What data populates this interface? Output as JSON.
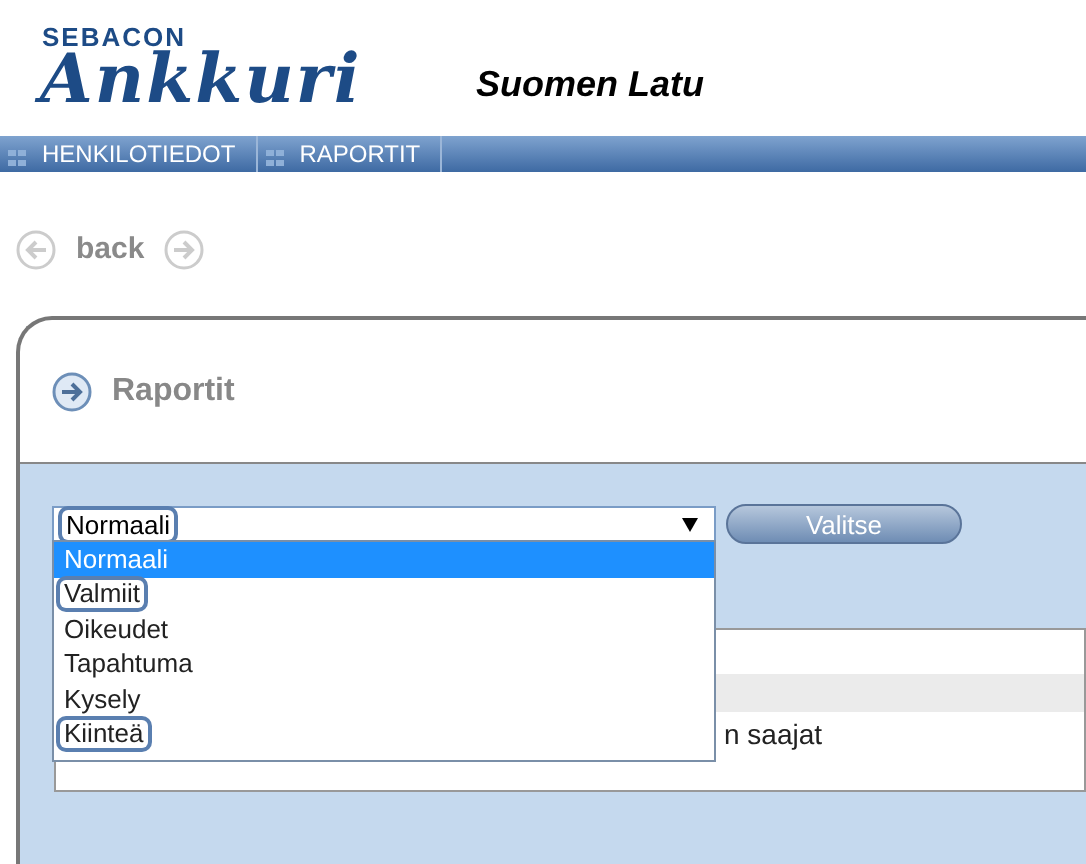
{
  "logo": {
    "brand": "SEBACON",
    "product": "Ankkuri"
  },
  "organization": "Suomen Latu",
  "nav": [
    {
      "label": "HENKILOTIEDOT"
    },
    {
      "label": "RAPORTIT"
    }
  ],
  "back": {
    "label": "back"
  },
  "panel": {
    "title": "Raportit",
    "select": {
      "value": "Normaali",
      "annotated": true,
      "expanded": true
    },
    "button": "Valitse",
    "options": [
      {
        "label": "Normaali",
        "selected": true,
        "annotated": false
      },
      {
        "label": "Valmiit",
        "selected": false,
        "annotated": true
      },
      {
        "label": "Oikeudet",
        "selected": false,
        "annotated": false
      },
      {
        "label": "Tapahtuma",
        "selected": false,
        "annotated": false
      },
      {
        "label": "Kysely",
        "selected": false,
        "annotated": false
      },
      {
        "label": "Kiinteä",
        "selected": false,
        "annotated": true
      }
    ],
    "behind_text": "n saajat"
  }
}
